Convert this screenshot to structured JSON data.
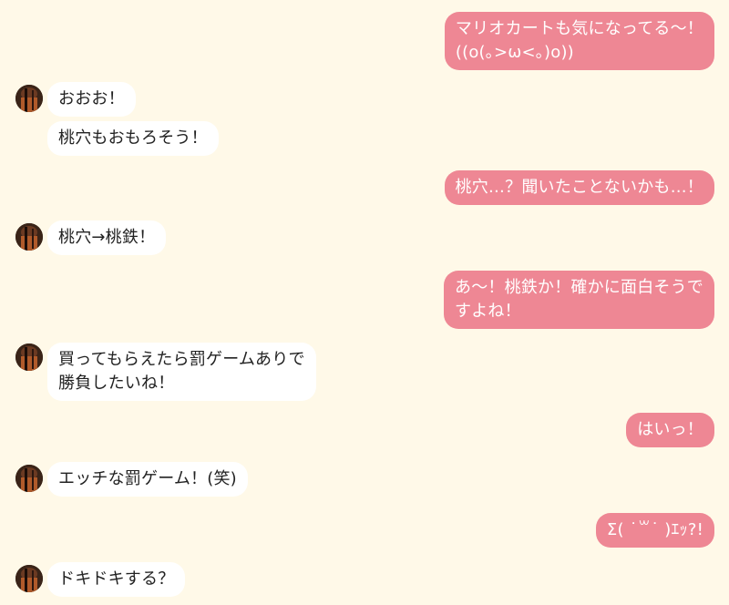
{
  "messages": [
    {
      "id": 1,
      "side": "out",
      "text": "マリオカートも気になってる〜！\n((o(｡>ω<｡)o))"
    },
    {
      "id": 2,
      "side": "in",
      "text": "おおお！"
    },
    {
      "id": 3,
      "side": "in",
      "text": "桃穴もおもろそう！"
    },
    {
      "id": 4,
      "side": "out",
      "text": "桃穴…？聞いたことないかも…！"
    },
    {
      "id": 5,
      "side": "in",
      "text": "桃穴→桃鉄！"
    },
    {
      "id": 6,
      "side": "out",
      "text": "あ〜！桃鉄か！確かに面白そうで\nすよね！"
    },
    {
      "id": 7,
      "side": "in",
      "text": "買ってもらえたら罰ゲームありで\n勝負したいね！"
    },
    {
      "id": 8,
      "side": "out",
      "text": "はいっ！"
    },
    {
      "id": 9,
      "side": "in",
      "text": "エッチな罰ゲーム！(笑)"
    },
    {
      "id": 10,
      "side": "out",
      "text": "Σ( ˙꒳˙ )ｴｯ?!"
    },
    {
      "id": 11,
      "side": "in",
      "text": "ドキドキする？"
    }
  ],
  "colors": {
    "background": "#fff9e8",
    "outgoing_bubble": "#ee8794",
    "incoming_bubble": "#ffffff",
    "outgoing_text": "#ffffff",
    "incoming_text": "#222222"
  },
  "icons": {
    "avatar": "contact-avatar"
  }
}
